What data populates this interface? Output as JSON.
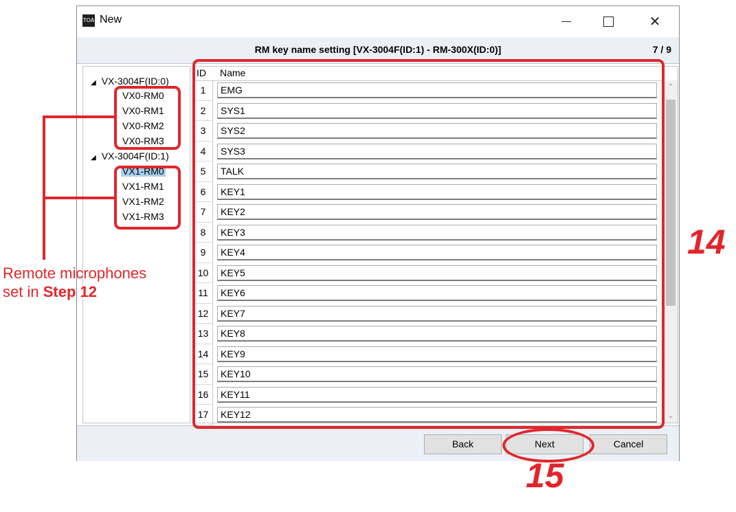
{
  "window": {
    "title": "New",
    "icon_label": "TOA",
    "controls": {
      "minimize": "—",
      "maximize": "□",
      "close": "✕"
    }
  },
  "header": {
    "title": "RM key name setting [VX-3004F(ID:1) - RM-300X(ID:0)]",
    "page": "7 / 9"
  },
  "tree": {
    "groups": [
      {
        "label": "VX-3004F(ID:0)",
        "children": [
          "VX0-RM0",
          "VX0-RM1",
          "VX0-RM2",
          "VX0-RM3"
        ]
      },
      {
        "label": "VX-3004F(ID:1)",
        "children": [
          "VX1-RM0",
          "VX1-RM1",
          "VX1-RM2",
          "VX1-RM3"
        ],
        "selected": "VX1-RM0"
      }
    ],
    "expand_glyph": "◢"
  },
  "grid": {
    "headers": {
      "id": "ID",
      "name": "Name"
    },
    "rows": [
      {
        "id": "1",
        "name": "EMG"
      },
      {
        "id": "2",
        "name": "SYS1"
      },
      {
        "id": "3",
        "name": "SYS2"
      },
      {
        "id": "4",
        "name": "SYS3"
      },
      {
        "id": "5",
        "name": "TALK"
      },
      {
        "id": "6",
        "name": "KEY1"
      },
      {
        "id": "7",
        "name": "KEY2"
      },
      {
        "id": "8",
        "name": "KEY3"
      },
      {
        "id": "9",
        "name": "KEY4"
      },
      {
        "id": "10",
        "name": "KEY5"
      },
      {
        "id": "11",
        "name": "KEY6"
      },
      {
        "id": "12",
        "name": "KEY7"
      },
      {
        "id": "13",
        "name": "KEY8"
      },
      {
        "id": "14",
        "name": "KEY9"
      },
      {
        "id": "15",
        "name": "KEY10"
      },
      {
        "id": "16",
        "name": "KEY11"
      },
      {
        "id": "17",
        "name": "KEY12"
      }
    ],
    "scroll": {
      "up": "⌃",
      "down": "⌄"
    }
  },
  "footer": {
    "back": "Back",
    "next": "Next",
    "cancel": "Cancel"
  },
  "annotations": {
    "callout_line1": "Remote microphones",
    "callout_line2_prefix": "set in ",
    "callout_line2_bold": "Step 12",
    "step_grid": "14",
    "step_next": "15",
    "color": "#e1262b"
  }
}
